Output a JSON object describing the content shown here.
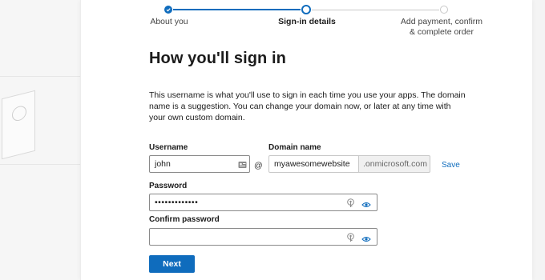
{
  "stepper": {
    "steps": [
      {
        "label": "About you",
        "state": "completed"
      },
      {
        "label": "Sign-in details",
        "state": "current"
      },
      {
        "label_line1": "Add payment, confirm",
        "label_line2": "& complete order",
        "state": "upcoming"
      }
    ]
  },
  "page": {
    "title": "How you'll sign in",
    "description": "This username is what you'll use to sign in each time you use your apps. The domain name is a suggestion. You can change your domain now, or later at any time with your own custom domain."
  },
  "form": {
    "username": {
      "label": "Username",
      "value": "john"
    },
    "at_symbol": "@",
    "domain": {
      "label": "Domain name",
      "value": "myawesomewebsite",
      "suffix": ".onmicrosoft.com",
      "save_label": "Save"
    },
    "password": {
      "label": "Password",
      "value": "•••••••••••••"
    },
    "confirm_password": {
      "label": "Confirm password",
      "value": ""
    },
    "next_label": "Next"
  },
  "colors": {
    "accent": "#0f6cbd",
    "step_inactive": "#c8c8c8"
  },
  "icons": [
    "checkmark-icon",
    "contact-card-icon",
    "key-icon",
    "eye-icon"
  ]
}
